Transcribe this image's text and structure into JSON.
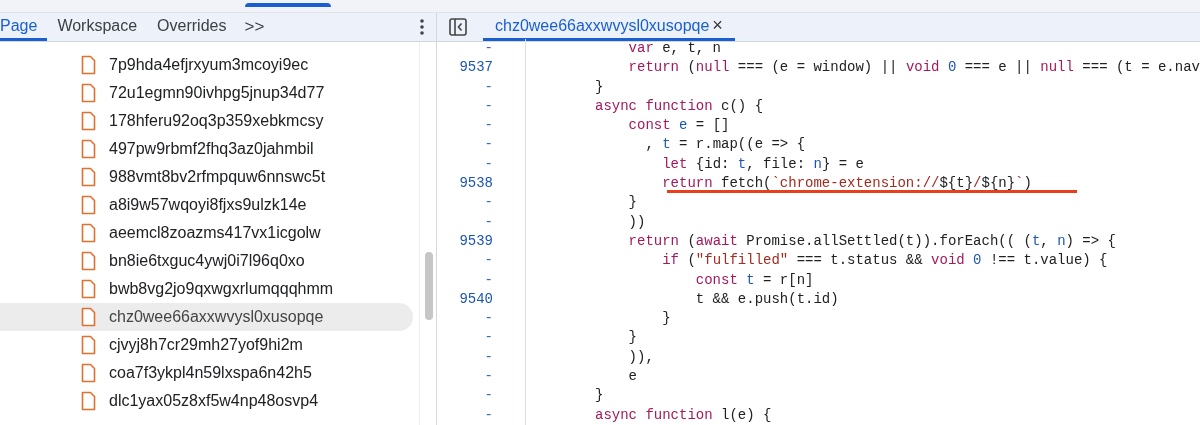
{
  "navigator": {
    "tabs": [
      {
        "label": "Page",
        "selected": true
      },
      {
        "label": "Workspace",
        "selected": false
      },
      {
        "label": "Overrides",
        "selected": false
      }
    ],
    "more": ">>",
    "files": [
      {
        "name": "7p9hda4efjrxyum3mcoyi9ec",
        "selected": false
      },
      {
        "name": "72u1egmn90ivhpg5jnup34d77",
        "selected": false
      },
      {
        "name": "178hferu92oq3p359xebkmcsy",
        "selected": false
      },
      {
        "name": "497pw9rbmf2fhq3az0jahmbil",
        "selected": false
      },
      {
        "name": "988vmt8bv2rfmpquw6nnswc5t",
        "selected": false
      },
      {
        "name": "a8i9w57wqoyi8fjxs9ulzk14e",
        "selected": false
      },
      {
        "name": "aeemcl8zoazms417vx1icgolw",
        "selected": false
      },
      {
        "name": "bn8ie6txguc4ywj0i7l96q0xo",
        "selected": false
      },
      {
        "name": "bwb8vg2jo9qxwgxrlumqqqhmm",
        "selected": false
      },
      {
        "name": "chz0wee66axxwvysl0xusopqe",
        "selected": true
      },
      {
        "name": "cjvyj8h7cr29mh27yof9hi2m",
        "selected": false
      },
      {
        "name": "coa7f3ykpl4n59lxspa6n42h5",
        "selected": false
      },
      {
        "name": "dlc1yax05z8xf5w4np48osvp4",
        "selected": false
      }
    ]
  },
  "editor": {
    "tab": {
      "label": "chz0wee66axxwvysl0xusopqe",
      "close": "×",
      "selected": true
    },
    "lines": [
      {
        "number": "-",
        "segments": [
          {
            "kind": "kw",
            "text": "    var"
          },
          {
            "kind": "plain",
            "text": " e, t, n"
          }
        ]
      },
      {
        "number": "9537",
        "segments": [
          {
            "kind": "kw",
            "text": "    return"
          },
          {
            "kind": "plain",
            "text": " ("
          },
          {
            "kind": "kw",
            "text": "null"
          },
          {
            "kind": "plain",
            "text": " === (e = window) || "
          },
          {
            "kind": "kw",
            "text": "void"
          },
          {
            "kind": "num",
            "text": " 0"
          },
          {
            "kind": "plain",
            "text": " === e || "
          },
          {
            "kind": "kw",
            "text": "null"
          },
          {
            "kind": "plain",
            "text": " === (t = e.nav"
          }
        ]
      },
      {
        "number": "-",
        "segments": [
          {
            "kind": "plain",
            "text": "}"
          }
        ]
      },
      {
        "number": "-",
        "segments": [
          {
            "kind": "kw",
            "text": "async function"
          },
          {
            "kind": "plain",
            "text": " c() {"
          }
        ]
      },
      {
        "number": "-",
        "segments": [
          {
            "kind": "kw",
            "text": "    const"
          },
          {
            "kind": "def",
            "text": " e"
          },
          {
            "kind": "plain",
            "text": " = []"
          }
        ]
      },
      {
        "number": "-",
        "segments": [
          {
            "kind": "plain",
            "text": "      , "
          },
          {
            "kind": "def",
            "text": "t"
          },
          {
            "kind": "plain",
            "text": " = r.map((e => {"
          }
        ]
      },
      {
        "number": "-",
        "segments": [
          {
            "kind": "kw",
            "text": "        let"
          },
          {
            "kind": "plain",
            "text": " {id: "
          },
          {
            "kind": "def",
            "text": "t"
          },
          {
            "kind": "plain",
            "text": ", file: "
          },
          {
            "kind": "def",
            "text": "n"
          },
          {
            "kind": "plain",
            "text": "} = e"
          }
        ]
      },
      {
        "number": "9538",
        "underlined": true,
        "segments": [
          {
            "kind": "kw",
            "text": "        return"
          },
          {
            "kind": "plain",
            "text": " fetch("
          },
          {
            "kind": "str",
            "text": "`chrome-extension://"
          },
          {
            "kind": "plain",
            "text": "${t}"
          },
          {
            "kind": "str",
            "text": "/"
          },
          {
            "kind": "plain",
            "text": "${n}"
          },
          {
            "kind": "str",
            "text": "`"
          },
          {
            "kind": "plain",
            "text": ")"
          }
        ]
      },
      {
        "number": "-",
        "segments": [
          {
            "kind": "plain",
            "text": "    }"
          }
        ]
      },
      {
        "number": "-",
        "segments": [
          {
            "kind": "plain",
            "text": "    ))"
          }
        ]
      },
      {
        "number": "9539",
        "segments": [
          {
            "kind": "kw",
            "text": "    return"
          },
          {
            "kind": "plain",
            "text": " ("
          },
          {
            "kind": "kw",
            "text": "await"
          },
          {
            "kind": "plain",
            "text": " Promise.allSettled(t)).forEach(( ("
          },
          {
            "kind": "def",
            "text": "t"
          },
          {
            "kind": "plain",
            "text": ", "
          },
          {
            "kind": "def",
            "text": "n"
          },
          {
            "kind": "plain",
            "text": ") => {"
          }
        ]
      },
      {
        "number": "-",
        "segments": [
          {
            "kind": "kw",
            "text": "        if"
          },
          {
            "kind": "plain",
            "text": " ("
          },
          {
            "kind": "str",
            "text": "\"fulfilled\""
          },
          {
            "kind": "plain",
            "text": " === t.status && "
          },
          {
            "kind": "kw",
            "text": "void"
          },
          {
            "kind": "num",
            "text": " 0"
          },
          {
            "kind": "plain",
            "text": " !== t.value) {"
          }
        ]
      },
      {
        "number": "-",
        "segments": [
          {
            "kind": "kw",
            "text": "            const"
          },
          {
            "kind": "def",
            "text": " t"
          },
          {
            "kind": "plain",
            "text": " = r[n]"
          }
        ]
      },
      {
        "number": "9540",
        "segments": [
          {
            "kind": "plain",
            "text": "            t && e.push(t.id)"
          }
        ]
      },
      {
        "number": "-",
        "segments": [
          {
            "kind": "plain",
            "text": "        }"
          }
        ]
      },
      {
        "number": "-",
        "segments": [
          {
            "kind": "plain",
            "text": "    }"
          }
        ]
      },
      {
        "number": "-",
        "segments": [
          {
            "kind": "plain",
            "text": "    )),"
          }
        ]
      },
      {
        "number": "-",
        "segments": [
          {
            "kind": "plain",
            "text": "    e"
          }
        ]
      },
      {
        "number": "-",
        "segments": [
          {
            "kind": "plain",
            "text": "}"
          }
        ]
      },
      {
        "number": "-",
        "segments": [
          {
            "kind": "kw",
            "text": "async function"
          },
          {
            "kind": "plain",
            "text": " l(e) {"
          }
        ]
      }
    ]
  }
}
